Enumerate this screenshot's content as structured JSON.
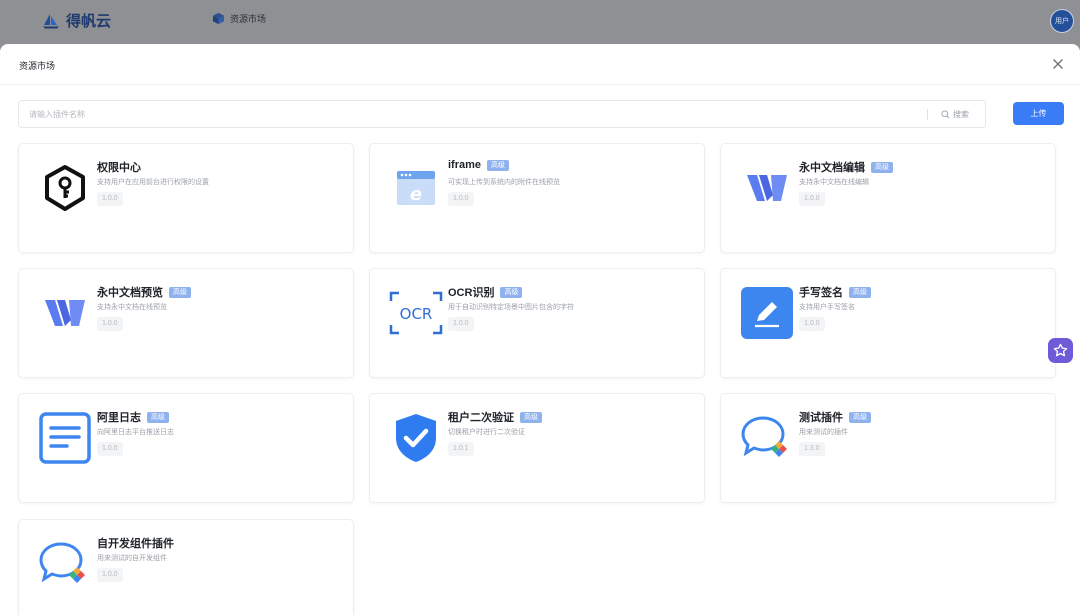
{
  "app": {
    "brand": "得帆云",
    "nav_item": "资源市场",
    "avatar_text": "用户"
  },
  "modal": {
    "title": "资源市场",
    "search_placeholder": "请输入插件名称",
    "search_button": "搜索",
    "upload_button": "上传"
  },
  "cards": [
    {
      "name": "权限中心",
      "tag": "",
      "desc": "支持用户在应用前台进行权限的设置",
      "version": "1.0.0",
      "icon": "shield-key-icon"
    },
    {
      "name": "iframe",
      "tag": "高级",
      "desc": "可实现上传到系统内的附件在线预览",
      "version": "1.0.0",
      "icon": "browser-e-icon"
    },
    {
      "name": "永中文档编辑",
      "tag": "高级",
      "desc": "支持永中文档在线编辑",
      "version": "1.0.0",
      "icon": "yozo-w-icon"
    },
    {
      "name": "永中文档预览",
      "tag": "高级",
      "desc": "支持永中文档在线预览",
      "version": "1.0.0",
      "icon": "yozo-w-icon"
    },
    {
      "name": "OCR识别",
      "tag": "高级",
      "desc": "用于自动识别特定场景中图片包含的字符",
      "version": "1.0.0",
      "icon": "ocr-icon"
    },
    {
      "name": "手写签名",
      "tag": "高级",
      "desc": "支持用户手写签名",
      "version": "1.0.0",
      "icon": "pen-sign-icon"
    },
    {
      "name": "阿里日志",
      "tag": "高级",
      "desc": "向阿里日志平台推送日志",
      "version": "1.0.0",
      "icon": "log-doc-icon"
    },
    {
      "name": "租户二次验证",
      "tag": "高级",
      "desc": "切换租户时进行二次验证",
      "version": "1.0.1",
      "icon": "shield-check-icon"
    },
    {
      "name": "测试插件",
      "tag": "高级",
      "desc": "用来测试的插件",
      "version": "1.3.0",
      "icon": "chat-bubble-icon"
    },
    {
      "name": "自开发组件插件",
      "tag": "",
      "desc": "用来测试的自开发组件",
      "version": "1.0.0",
      "icon": "chat-bubble-icon"
    }
  ],
  "colors": {
    "primary": "#3a7cf6",
    "tag_bg": "#8fb2ef",
    "overlay": "#8f9094"
  }
}
